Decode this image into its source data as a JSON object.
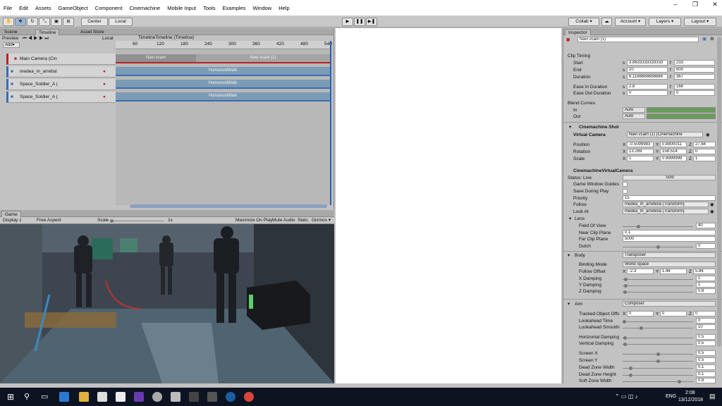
{
  "menu": [
    "File",
    "Edit",
    "Assets",
    "GameObject",
    "Component",
    "Cinemachine",
    "Mobile Input",
    "Tools",
    "Examples",
    "Window",
    "Help"
  ],
  "window_controls": {
    "minimize": "–",
    "restore": "❐",
    "close": "✕"
  },
  "toolbar": {
    "center": "Center",
    "local": "Local",
    "collab": "Collab ▾",
    "account": "Account ▾",
    "layers": "Layers ▾",
    "layout": "Layout ▾"
  },
  "timeline": {
    "tabs": [
      "Scene",
      "Timeline",
      "Asset Store"
    ],
    "preview_label": "Preview",
    "local_label": "Local",
    "add_label": "Add▾",
    "title": "TimelineTimeline (Timeline)",
    "ruler": [
      "60",
      "120",
      "180",
      "240",
      "300",
      "360",
      "420",
      "480",
      "540"
    ],
    "tracks": [
      "Main Camera (Cin",
      "medea_m_arrebol",
      "Space_Soldier_A (",
      "Space_Soldier_A ("
    ],
    "camera_clips": [
      "Navi vcam",
      "Navi vcam (1)"
    ],
    "anim_clip": "HumanoidWalk"
  },
  "game": {
    "tab": "Game",
    "display": "Display 1",
    "aspect": "Free Aspect",
    "scale_label": "Scale",
    "scale_value": "1x",
    "maximize": "Maximize On Play",
    "mute": "Mute Audio",
    "stats": "Stats",
    "gizmos": "Gizmos ▾"
  },
  "inspector": {
    "tab": "Inspector",
    "object_name": "Navi vcam (1)",
    "clip_timing": {
      "title": "Clip Timing",
      "rows": [
        {
          "label": "Start",
          "s": "3.8833333333333",
          "f": "233"
        },
        {
          "label": "End",
          "s": "10",
          "f": "600"
        },
        {
          "label": "Duration",
          "s": "6.1166666666666",
          "f": "367"
        },
        {
          "label": "Ease In Duration",
          "s": "2.8",
          "f": "168"
        },
        {
          "label": "Ease Out Duration",
          "s": "0",
          "f": "0"
        }
      ],
      "s_prefix": "s",
      "f_prefix": "f"
    },
    "blend_curves": {
      "title": "Blend Curves",
      "in": "In",
      "out": "Out",
      "mode": "Auto"
    },
    "shot": {
      "title": "Cinemachine Shot",
      "vcam_label": "Virtual Camera",
      "vcam_value": "Navi vcam (1) (Cinemachine",
      "position_label": "Position",
      "position": [
        "-0.5099983",
        "0.8800011",
        "27.84"
      ],
      "rotation_label": "Rotation",
      "rotation": [
        "13.269",
        "158.514",
        "0"
      ],
      "scale_label": "Scale",
      "scale": [
        "1",
        "0.9999999",
        "1"
      ]
    },
    "vcam": {
      "title": "CinemachineVirtualCamera",
      "status": "Status: Live",
      "solo": "Solo",
      "guides": "Game Window Guides",
      "save": "Save During Play",
      "priority_label": "Priority",
      "priority": "15",
      "follow_label": "Follow",
      "follow": "medea_m_arrebola (Transform)",
      "lookat_label": "Look At",
      "lookat": "medea_m_arrebola (Transform)",
      "lens": "Lens",
      "fov_label": "Field Of View",
      "fov": "40",
      "near_label": "Near Clip Plane",
      "near": "0.1",
      "far_label": "Far Clip Plane",
      "far": "5000",
      "dutch_label": "Dutch",
      "dutch": "0"
    },
    "body": {
      "title": "Body",
      "mode": "Transposer",
      "binding_label": "Binding Mode",
      "binding": "World Space",
      "offset_label": "Follow Offset",
      "offset": [
        "-2.3",
        "1.48",
        "5.84"
      ],
      "xd_label": "X Damping",
      "xd": "1",
      "yd_label": "Y Damping",
      "yd": "1",
      "zd_label": "Z Damping",
      "zd": "0.8"
    },
    "aim": {
      "title": "Aim",
      "mode": "Composer",
      "tracked_label": "Tracked Object Offs",
      "tracked": [
        "0",
        "0",
        "0"
      ],
      "lookahead_label": "Lookahead Time",
      "lookahead": "0",
      "smooth_label": "Lookahead Smoothi",
      "smooth": "10",
      "hd_label": "Horizontal Damping",
      "hd": "0.5",
      "vd_label": "Vertical Damping",
      "vd": "0.5",
      "sx_label": "Screen X",
      "sx": "0.5",
      "sy_label": "Screen Y",
      "sy": "0.5",
      "dzw_label": "Dead Zone Width",
      "dzw": "0.1",
      "dzh_label": "Dead Zone Height",
      "dzh": "0.1",
      "szw_label": "Soft Zone Width",
      "szw": "0.8"
    }
  },
  "taskbar": {
    "lang": "ENG",
    "time": "2:08",
    "date": "13/12/2018"
  }
}
